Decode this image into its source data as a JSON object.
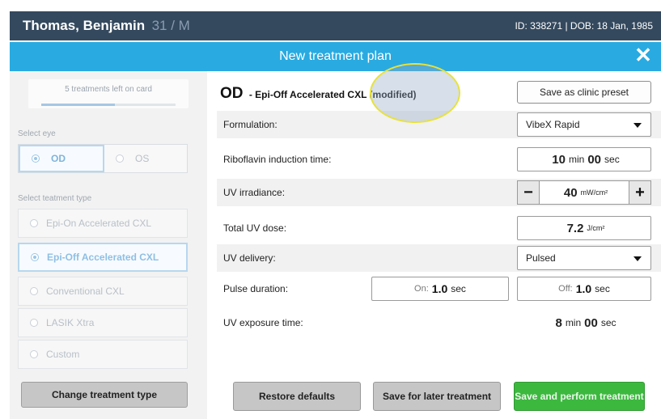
{
  "header": {
    "patient_name": "Thomas, Benjamin",
    "patient_meta": "31 / M",
    "patient_id_dob": "ID: 338271 | DOB: 18 Jan, 1985"
  },
  "titlebar": {
    "title": "New treatment plan",
    "close_icon": "close-icon",
    "close_glyph": "✕"
  },
  "sidebar": {
    "cards_left": "5 treatments left on card",
    "cards_progress": 0.55,
    "select_eye_label": "Select eye",
    "eyes": [
      {
        "label": "OD",
        "selected": true
      },
      {
        "label": "OS",
        "selected": false
      }
    ],
    "select_type_label": "Select teatment type",
    "treatment_types": [
      {
        "label": "Epi-On Accelerated CXL",
        "selected": false
      },
      {
        "label": "Epi-Off Accelerated CXL",
        "selected": true
      },
      {
        "label": "Conventional CXL",
        "selected": false
      },
      {
        "label": "LASIK Xtra",
        "selected": false
      },
      {
        "label": "Custom",
        "selected": false
      }
    ],
    "change_button": "Change treatment type"
  },
  "main": {
    "plan_eye": "OD",
    "plan_title": "- Epi-Off Accelerated CXL (modified)",
    "save_preset_button": "Save as clinic preset",
    "formulation": {
      "label": "Formulation:",
      "value": "VibeX Rapid"
    },
    "induction": {
      "label": "Riboflavin induction time:",
      "min": "10",
      "min_unit": "min",
      "sec": "00",
      "sec_unit": "sec"
    },
    "irradiance": {
      "label": "UV irradiance:",
      "value": "40",
      "unit": "mW/cm²",
      "minus": "−",
      "plus": "+"
    },
    "dose": {
      "label": "Total UV dose:",
      "value": "7.2",
      "unit": "J/cm²"
    },
    "delivery": {
      "label": "UV delivery:",
      "value": "Pulsed"
    },
    "pulse": {
      "label": "Pulse duration:",
      "on_label": "On:",
      "on_value": "1.0",
      "off_label": "Off:",
      "off_value": "1.0",
      "unit": "sec"
    },
    "exposure": {
      "label": "UV exposure time:",
      "min": "8",
      "min_unit": "min",
      "sec": "00",
      "sec_unit": "sec"
    },
    "restore_button": "Restore defaults",
    "save_later_button": "Save for later treatment",
    "perform_button": "Save and perform treatment"
  },
  "colors": {
    "header": "#34495e",
    "titlebar": "#29aae1",
    "perform": "#3cb83f",
    "selection": "#b7d7ef"
  }
}
